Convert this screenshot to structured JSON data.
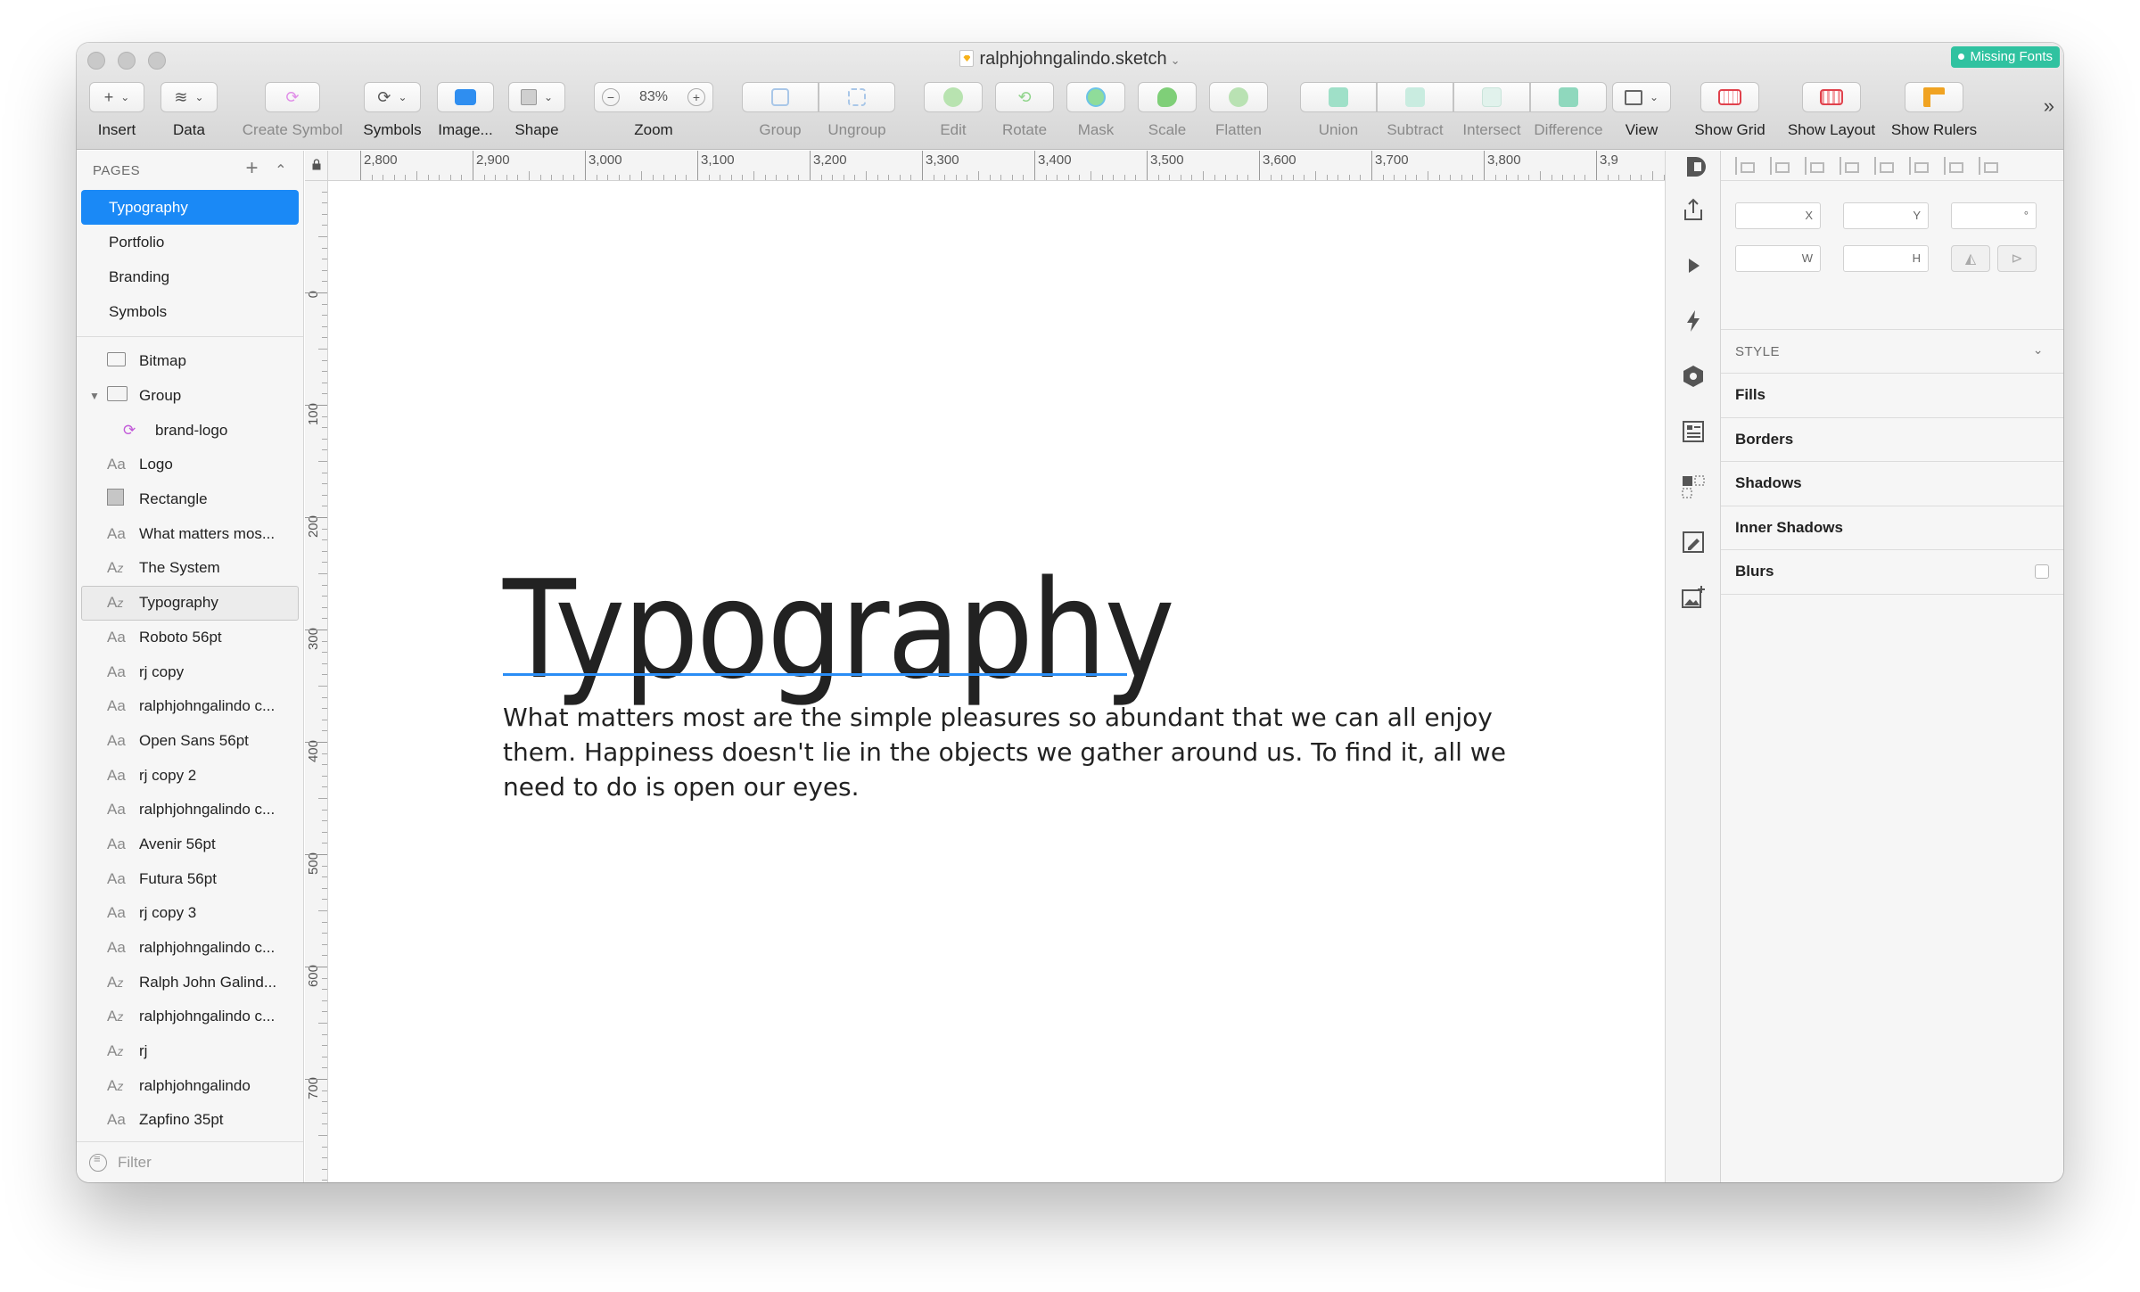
{
  "window": {
    "title": "ralphjohngalindo.sketch",
    "badge": "Missing Fonts"
  },
  "toolbar": {
    "items": [
      {
        "label": "Insert",
        "glyph": "+"
      },
      {
        "label": "Data",
        "glyph": "≋"
      },
      {
        "label": "Create Symbol",
        "glyph": "⟳"
      },
      {
        "label": "Symbols",
        "glyph": "⟳"
      },
      {
        "label": "Image...",
        "glyph": "▦"
      },
      {
        "label": "Shape",
        "glyph": "□"
      },
      {
        "label": "Zoom",
        "value": "83%"
      },
      {
        "label": "Group"
      },
      {
        "label": "Ungroup"
      },
      {
        "label": "Edit"
      },
      {
        "label": "Rotate"
      },
      {
        "label": "Mask"
      },
      {
        "label": "Scale"
      },
      {
        "label": "Flatten"
      },
      {
        "label": "Union"
      },
      {
        "label": "Subtract"
      },
      {
        "label": "Intersect"
      },
      {
        "label": "Difference"
      },
      {
        "label": "View"
      },
      {
        "label": "Show Grid"
      },
      {
        "label": "Show Layout"
      },
      {
        "label": "Show Rulers"
      }
    ],
    "zoom_minus": "−",
    "zoom_plus": "+",
    "more": "»"
  },
  "sidebar": {
    "pages_header": "PAGES",
    "add": "+",
    "collapse": "⌃",
    "pages": [
      "Typography",
      "Portfolio",
      "Branding",
      "Symbols"
    ],
    "layers": [
      {
        "icon": "bitmap",
        "name": "Bitmap"
      },
      {
        "icon": "folder",
        "name": "Group"
      },
      {
        "icon": "symbol",
        "name": "brand-logo"
      },
      {
        "icon": "Aa",
        "name": "Logo"
      },
      {
        "icon": "rect",
        "name": "Rectangle"
      },
      {
        "icon": "Aa",
        "name": "What matters mos..."
      },
      {
        "icon": "Az",
        "name": "The System"
      },
      {
        "icon": "Az",
        "name": "Typography"
      },
      {
        "icon": "Aa",
        "name": "Roboto 56pt"
      },
      {
        "icon": "Aa",
        "name": "rj copy"
      },
      {
        "icon": "Aa",
        "name": "ralphjohngalindo c..."
      },
      {
        "icon": "Aa",
        "name": "Open Sans 56pt"
      },
      {
        "icon": "Aa",
        "name": "rj copy 2"
      },
      {
        "icon": "Aa",
        "name": "ralphjohngalindo c..."
      },
      {
        "icon": "Aa",
        "name": "Avenir 56pt"
      },
      {
        "icon": "Aa",
        "name": "Futura 56pt"
      },
      {
        "icon": "Aa",
        "name": "rj copy 3"
      },
      {
        "icon": "Aa",
        "name": "ralphjohngalindo c..."
      },
      {
        "icon": "Az",
        "name": "Ralph John Galind..."
      },
      {
        "icon": "Az",
        "name": "ralphjohngalindo c..."
      },
      {
        "icon": "Az",
        "name": "rj"
      },
      {
        "icon": "Az",
        "name": "ralphjohngalindo"
      },
      {
        "icon": "Aa",
        "name": "Zapfino 35pt"
      }
    ],
    "filter_placeholder": "Filter"
  },
  "rulers": {
    "h_labels": [
      "2,800",
      "2,900",
      "3,000",
      "3,100",
      "3,200",
      "3,300",
      "3,400",
      "3,500",
      "3,600",
      "3,700",
      "3,800",
      "3,9"
    ],
    "v_labels": [
      "0",
      "100",
      "200",
      "300",
      "400",
      "500",
      "600",
      "700"
    ]
  },
  "canvas": {
    "heading": "Typography",
    "body": "What matters most are the simple pleasures so abundant that we can all enjoy them. Happiness doesn't lie in the objects we gather around us. To find it, all we need to do is open our eyes."
  },
  "inspector": {
    "x_label": "X",
    "y_label": "Y",
    "rotation_label": "°",
    "w_label": "W",
    "h_label": "H",
    "style_header": "STYLE",
    "style_rows": [
      "Fills",
      "Borders",
      "Shadows",
      "Inner Shadows",
      "Blurs"
    ]
  },
  "colors": {
    "accent": "#1a89f6",
    "badge": "#30c2a0",
    "underline": "#2a8df5"
  }
}
